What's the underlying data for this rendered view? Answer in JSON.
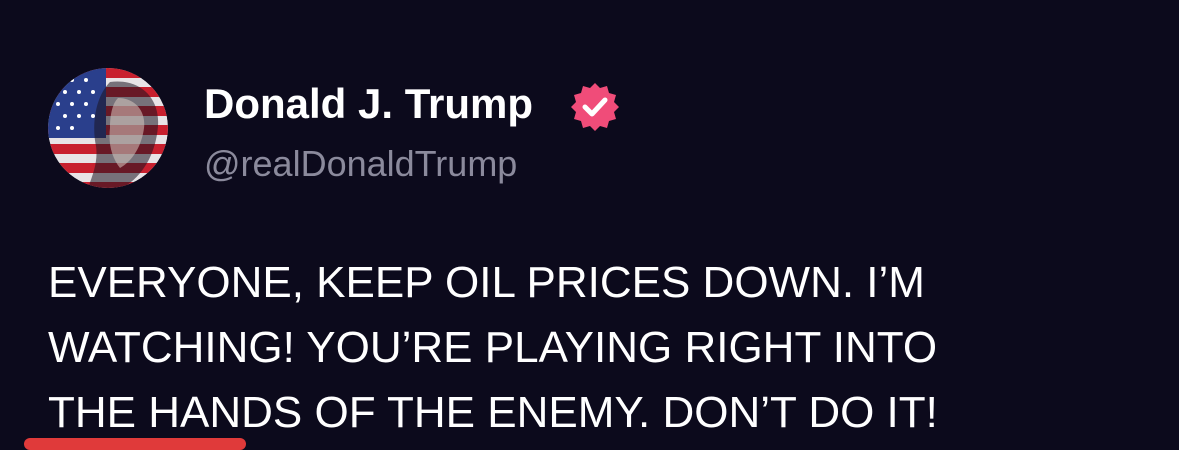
{
  "post": {
    "author": {
      "display_name": "Donald J. Trump",
      "handle": "@realDonaldTrump",
      "verified": true,
      "avatar_icon": "avatar-flag-portrait-icon",
      "verified_icon": "verified-badge-icon"
    },
    "text_lines": [
      "EVERYONE, KEEP OIL PRICES DOWN. I’M",
      "WATCHING! YOU’RE PLAYING RIGHT INTO",
      "THE HANDS OF THE ENEMY. DON’T DO IT!"
    ]
  },
  "colors": {
    "background": "#0c0a1c",
    "name": "#ffffff",
    "handle": "#8b8a9c",
    "verified_badge": "#f04c79",
    "accent_bar": "#e03a3a"
  }
}
